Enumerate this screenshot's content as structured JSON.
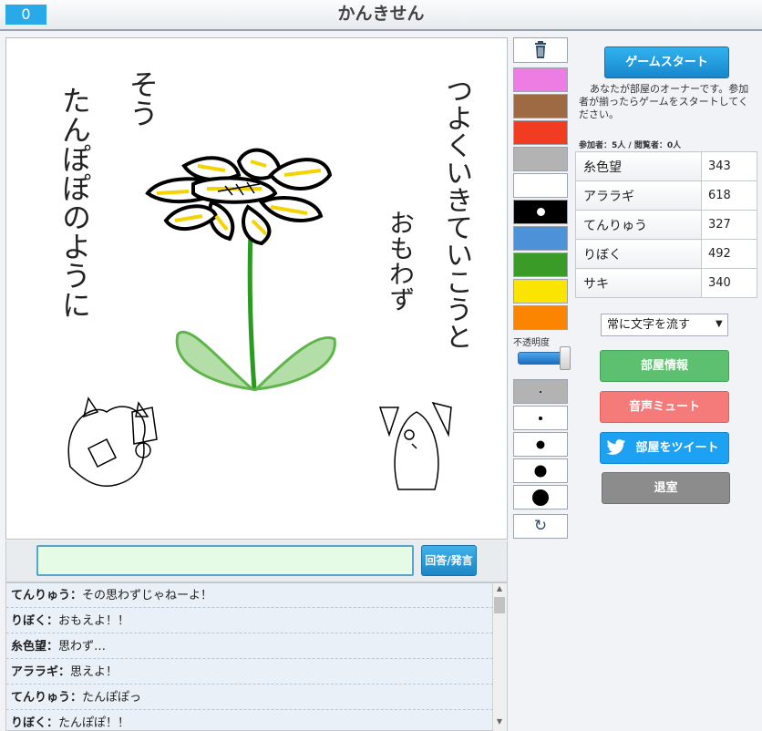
{
  "header": {
    "counter": "0",
    "title": "かんきせん"
  },
  "canvas": {
    "texts": [
      {
        "text": "たんぽぽのように"
      },
      {
        "text": "そう"
      },
      {
        "text": "つよくいきていこうと"
      },
      {
        "text": "おもわず"
      }
    ]
  },
  "answer": {
    "input_value": "",
    "button_label": "回答/発言"
  },
  "chat": {
    "messages": [
      {
        "name": "てんりゅう",
        "text": "その思わずじゃねーよ！"
      },
      {
        "name": "りぼく",
        "text": "おもえよ！！"
      },
      {
        "name": "糸色望",
        "text": "思わず…"
      },
      {
        "name": "アララギ",
        "text": "思えよ！"
      },
      {
        "name": "てんりゅう",
        "text": "たんぽぽっ"
      },
      {
        "name": "りぼく",
        "text": "たんぽぽ！！"
      }
    ]
  },
  "tools": {
    "colors": [
      "#ee7de3",
      "#9d6a44",
      "#f23c22",
      "#b3b3b3",
      "#ffffff",
      "#000000",
      "#4d91d9",
      "#3a9b27",
      "#fbe400",
      "#fb8500"
    ],
    "selected_color": "#000000",
    "opacity_label": "不透明度",
    "opacity_percent": 100,
    "brush_sizes": [
      2,
      4,
      9,
      13,
      18
    ],
    "selected_size": 2,
    "trash_icon": "trash-icon",
    "undo_icon": "↻"
  },
  "panel": {
    "start_label": "ゲームスタート",
    "owner_message": "あなたが部屋のオーナーです。参加者が揃ったらゲームをスタートしてください。",
    "member_count": "参加者：5人 / 閲覧者：0人",
    "players": [
      {
        "name": "糸色望",
        "score": "343"
      },
      {
        "name": "アララギ",
        "score": "618"
      },
      {
        "name": "てんりゅう",
        "score": "327"
      },
      {
        "name": "りぼく",
        "score": "492"
      },
      {
        "name": "サキ",
        "score": "340"
      }
    ],
    "flow_option": "常に文字を流す",
    "room_info_label": "部屋情報",
    "mute_label": "音声ミュート",
    "tweet_label": "部屋をツイート",
    "leave_label": "退室"
  },
  "colors": {
    "accent": "#2aa9e8",
    "green": "#5cc070",
    "red": "#f57b7b",
    "twitter": "#1da1f2",
    "gray": "#8c8c8c"
  }
}
